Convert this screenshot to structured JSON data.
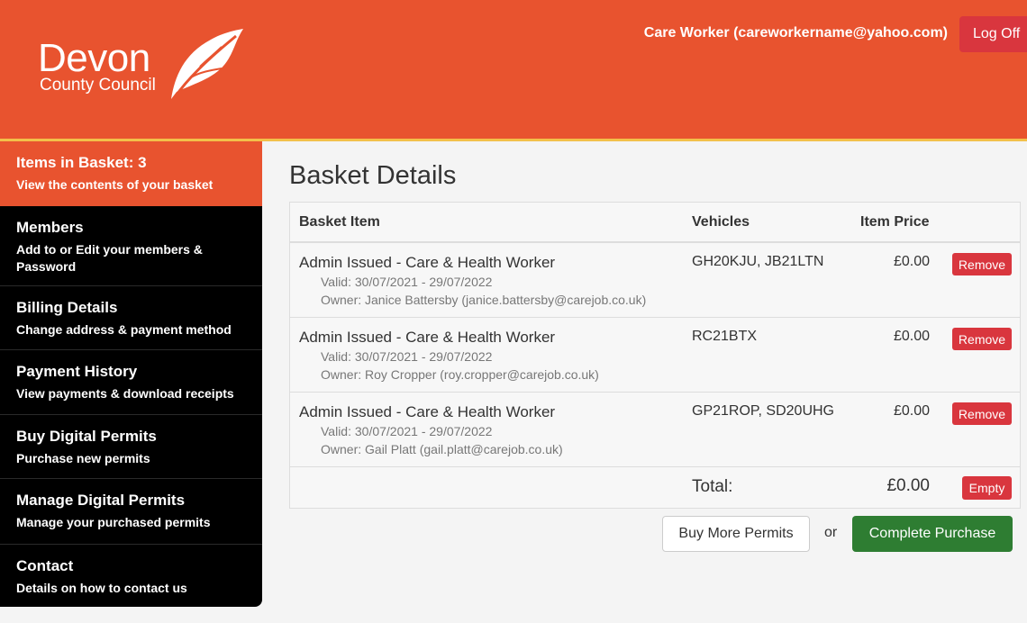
{
  "header": {
    "logo_line1": "Devon",
    "logo_line2": "County Council",
    "user_label": "Care Worker (careworkername@yahoo.com)",
    "logoff_label": "Log Off",
    "brand_color": "#e8532f"
  },
  "sidebar": {
    "items": [
      {
        "title": "Items in Basket: 3",
        "subtitle": "View the contents of your basket"
      },
      {
        "title": "Members",
        "subtitle": "Add to or Edit your members & Password"
      },
      {
        "title": "Billing Details",
        "subtitle": "Change address & payment method"
      },
      {
        "title": "Payment History",
        "subtitle": "View payments & download receipts"
      },
      {
        "title": "Buy Digital Permits",
        "subtitle": "Purchase new permits"
      },
      {
        "title": "Manage Digital Permits",
        "subtitle": "Manage your purchased permits"
      },
      {
        "title": "Contact",
        "subtitle": "Details on how to contact us"
      }
    ]
  },
  "main": {
    "title": "Basket Details",
    "columns": {
      "item": "Basket Item",
      "vehicles": "Vehicles",
      "price": "Item Price"
    },
    "rows": [
      {
        "name": "Admin Issued - Care & Health Worker",
        "valid": "Valid: 30/07/2021 - 29/07/2022",
        "owner": "Owner: Janice Battersby (janice.battersby@carejob.co.uk)",
        "vehicles": "GH20KJU, JB21LTN",
        "price": "£0.00",
        "remove": "Remove"
      },
      {
        "name": "Admin Issued - Care & Health Worker",
        "valid": "Valid: 30/07/2021 - 29/07/2022",
        "owner": "Owner: Roy Cropper (roy.cropper@carejob.co.uk)",
        "vehicles": "RC21BTX",
        "price": "£0.00",
        "remove": "Remove"
      },
      {
        "name": "Admin Issued - Care & Health Worker",
        "valid": "Valid: 30/07/2021 - 29/07/2022",
        "owner": "Owner: Gail Platt (gail.platt@carejob.co.uk)",
        "vehicles": "GP21ROP, SD20UHG",
        "price": "£0.00",
        "remove": "Remove"
      }
    ],
    "total_label": "Total:",
    "total_value": "£0.00",
    "empty_label": "Empty",
    "buy_more_label": "Buy More Permits",
    "or_label": "or",
    "complete_label": "Complete Purchase"
  }
}
